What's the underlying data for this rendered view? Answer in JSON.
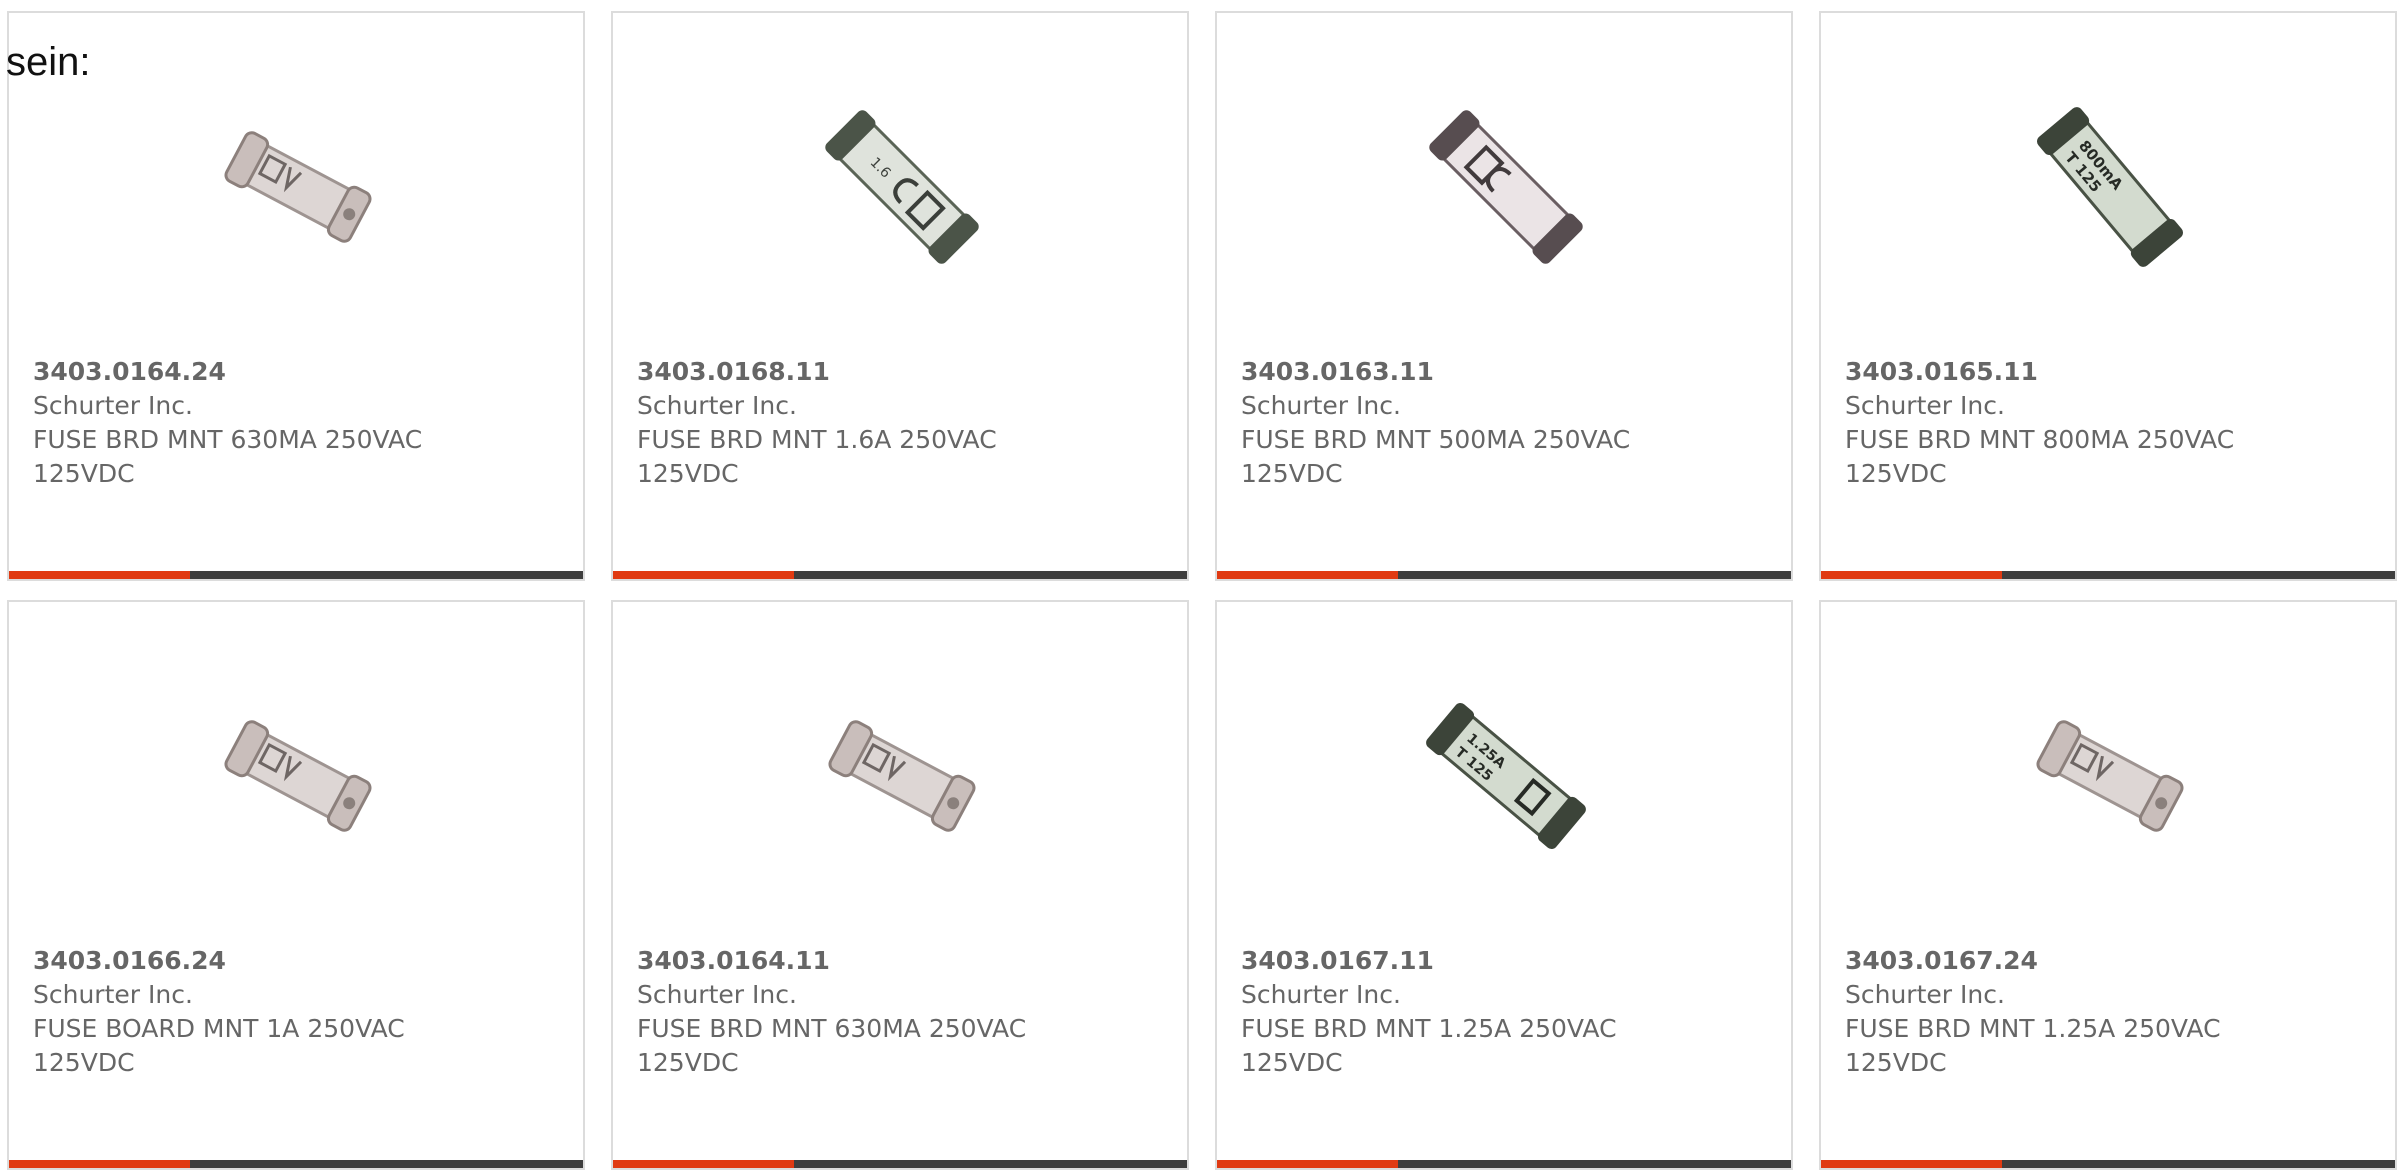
{
  "intro_text": "sein:",
  "colors": {
    "card_border": "#dcdcdc",
    "text": "#666666",
    "bar_dark": "#3e3e3e",
    "bar_accent": "#e03a12"
  },
  "products": [
    {
      "part_number": "3403.0164.24",
      "manufacturer": "Schurter Inc.",
      "description": "FUSE BRD MNT 630MA 250VAC 125VDC",
      "image": "fuse-light-icon"
    },
    {
      "part_number": "3403.0168.11",
      "manufacturer": "Schurter Inc.",
      "description": "FUSE BRD MNT 1.6A 250VAC 125VDC",
      "image": "fuse-green-icon"
    },
    {
      "part_number": "3403.0163.11",
      "manufacturer": "Schurter Inc.",
      "description": "FUSE BRD MNT 500MA 250VAC 125VDC",
      "image": "fuse-pink-icon"
    },
    {
      "part_number": "3403.0165.11",
      "manufacturer": "Schurter Inc.",
      "description": "FUSE BRD MNT 800MA 250VAC 125VDC",
      "image": "fuse-green-icon"
    },
    {
      "part_number": "3403.0166.24",
      "manufacturer": "Schurter Inc.",
      "description": "FUSE BOARD MNT 1A 250VAC 125VDC",
      "image": "fuse-light-icon"
    },
    {
      "part_number": "3403.0164.11",
      "manufacturer": "Schurter Inc.",
      "description": "FUSE BRD MNT 630MA 250VAC 125VDC",
      "image": "fuse-light-icon"
    },
    {
      "part_number": "3403.0167.11",
      "manufacturer": "Schurter Inc.",
      "description": "FUSE BRD MNT 1.25A 250VAC 125VDC",
      "image": "fuse-green-icon"
    },
    {
      "part_number": "3403.0167.24",
      "manufacturer": "Schurter Inc.",
      "description": "FUSE BRD MNT 1.25A 250VAC 125VDC",
      "image": "fuse-light-icon"
    }
  ]
}
